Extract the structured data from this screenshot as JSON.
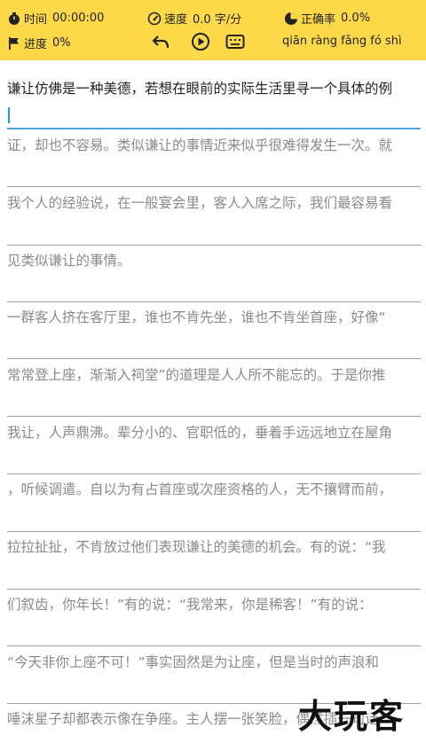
{
  "stats": {
    "time_label": "时间",
    "time_value": "00:00:00",
    "speed_label": "速度",
    "speed_value": "0.0 字/分",
    "accuracy_label": "正确率",
    "accuracy_value": "0.0%",
    "progress_label": "进度",
    "progress_value": "0%"
  },
  "toolbar": {
    "pinyin": "qiān ràng fǎng fó shì"
  },
  "lines": [
    {
      "text": "谦让仿佛是一种美德，若想在眼前的实际生活里寻一个具体的例",
      "style": "source"
    },
    {
      "text": "证，却也不容易。类似谦让的事情近来似乎很难得发生一次。就",
      "style": "hint"
    },
    {
      "text": "我个人的经验说，在一般宴会里，客人入席之际，我们最容易看",
      "style": "hint"
    },
    {
      "text": "见类似谦让的事情。",
      "style": "hint"
    },
    {
      "text": "一群客人挤在客厅里，谁也不肯先坐，谁也不肯坐首座，好像“",
      "style": "hint"
    },
    {
      "text": "常常登上座，渐渐入祠堂”的道理是人人所不能忘的。于是你推",
      "style": "hint"
    },
    {
      "text": "我让，人声鼎沸。辈分小的、官职低的，垂着手远远地立在屋角",
      "style": "hint"
    },
    {
      "text": "，听候调遣。自以为有占首座或次座资格的人，无不攘臂而前，",
      "style": "hint"
    },
    {
      "text": "拉拉扯扯，不肯放过他们表现谦让的美德的机会。有的说：“我",
      "style": "hint"
    },
    {
      "text": "们叙齿，你年长！”有的说：“我常来，你是稀客！”有的说：",
      "style": "hint"
    },
    {
      "text": "“今天非你上座不可！”事实固然是为让座，但是当时的声浪和",
      "style": "hint"
    },
    {
      "text": "唾沫星子却都表示像在争座。主人摆一张笑脸，偶然插一句话",
      "style": "hint"
    }
  ],
  "watermark": "大玩客"
}
